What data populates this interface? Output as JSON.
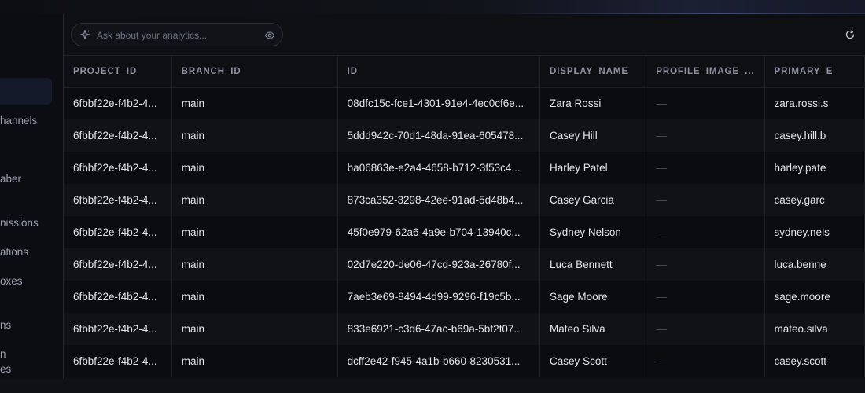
{
  "sidebar": {
    "items": [
      {
        "label": "hannels"
      },
      {
        "label": "aber"
      },
      {
        "label": "nissions"
      },
      {
        "label": "ations"
      },
      {
        "label": "oxes"
      },
      {
        "label": "ns"
      },
      {
        "label": "n"
      },
      {
        "label": "es"
      }
    ]
  },
  "toolbar": {
    "ask_placeholder": "Ask about your analytics...",
    "ask_icon": "sparkle-icon",
    "visibility_icon": "eye-icon",
    "refresh_icon": "refresh-icon"
  },
  "table": {
    "columns": [
      "PROJECT_ID",
      "BRANCH_ID",
      "ID",
      "DISPLAY_NAME",
      "PROFILE_IMAGE_...",
      "PRIMARY_E"
    ],
    "rows": [
      [
        "6fbbf22e-f4b2-4...",
        "main",
        "08dfc15c-fce1-4301-91e4-4ec0cf6e...",
        "Zara Rossi",
        "—",
        "zara.rossi.s"
      ],
      [
        "6fbbf22e-f4b2-4...",
        "main",
        "5ddd942c-70d1-48da-91ea-605478...",
        "Casey Hill",
        "—",
        "casey.hill.b"
      ],
      [
        "6fbbf22e-f4b2-4...",
        "main",
        "ba06863e-e2a4-4658-b712-3f53c4...",
        "Harley Patel",
        "—",
        "harley.pate"
      ],
      [
        "6fbbf22e-f4b2-4...",
        "main",
        "873ca352-3298-42ee-91ad-5d48b4...",
        "Casey Garcia",
        "—",
        "casey.garc"
      ],
      [
        "6fbbf22e-f4b2-4...",
        "main",
        "45f0e979-62a6-4a9e-b704-13940c...",
        "Sydney Nelson",
        "—",
        "sydney.nels"
      ],
      [
        "6fbbf22e-f4b2-4...",
        "main",
        "02d7e220-de06-47cd-923a-26780f...",
        "Luca Bennett",
        "—",
        "luca.benne"
      ],
      [
        "6fbbf22e-f4b2-4...",
        "main",
        "7aeb3e69-8494-4d99-9296-f19c5b...",
        "Sage Moore",
        "—",
        "sage.moore"
      ],
      [
        "6fbbf22e-f4b2-4...",
        "main",
        "833e6921-c3d6-47ac-b69a-5bf2f07...",
        "Mateo Silva",
        "—",
        "mateo.silva"
      ],
      [
        "6fbbf22e-f4b2-4...",
        "main",
        "dcff2e42-f945-4a1b-b660-8230531...",
        "Casey Scott",
        "—",
        "casey.scott"
      ]
    ]
  },
  "colors": {
    "background": "#0b0c10",
    "active_nav": "#141a2a",
    "text": "#e3e5ea",
    "muted": "#8d93a0"
  }
}
